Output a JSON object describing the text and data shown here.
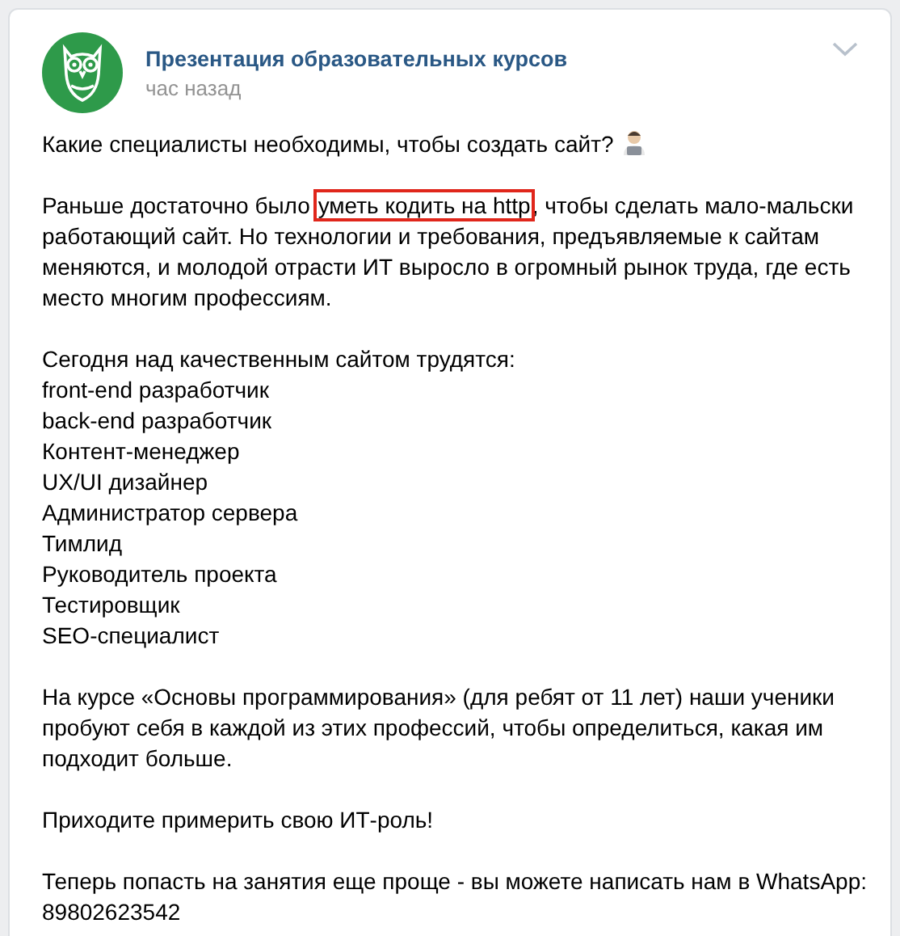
{
  "post": {
    "author": "Презентация образовательных курсов",
    "time": "час назад",
    "blocks": [
      {
        "kind": "text",
        "text": "Какие специалисты необходимы, чтобы создать сайт?",
        "icon": true
      },
      {
        "kind": "marked",
        "before": "Раньше достаточно было",
        "marked": "уметь кодить на http",
        "after": ", чтобы сделать мало-мальски работающий сайт. Но технологии и требования, предъявляемые к сайтам меняются, и молодой отрасти ИТ выросло в огромный рынок труда, где есть место многим профессиям."
      },
      {
        "kind": "lines",
        "lines": [
          "Сегодня над качественным сайтом трудятся:",
          "front-end разработчик",
          "back-end разработчик",
          "Контент-менеджер",
          "UX/UI дизайнер",
          "Администратор сервера",
          "Тимлид",
          "Руководитель проекта",
          "Тестировщик",
          "SEO-специалист"
        ]
      },
      {
        "kind": "text",
        "text": "На курсе «Основы программирования» (для ребят от 11 лет) наши ученики пробуют себя в каждой из этих профессий, чтобы определиться, какая им подходит больше.",
        "icon": false
      },
      {
        "kind": "text",
        "text": "Приходите примерить свою ИТ-роль!",
        "icon": false
      },
      {
        "kind": "lines",
        "lines": [
          "Теперь попасть на занятия еще проще - вы можете написать нам в WhatsApp:",
          "89802623542"
        ]
      }
    ]
  }
}
